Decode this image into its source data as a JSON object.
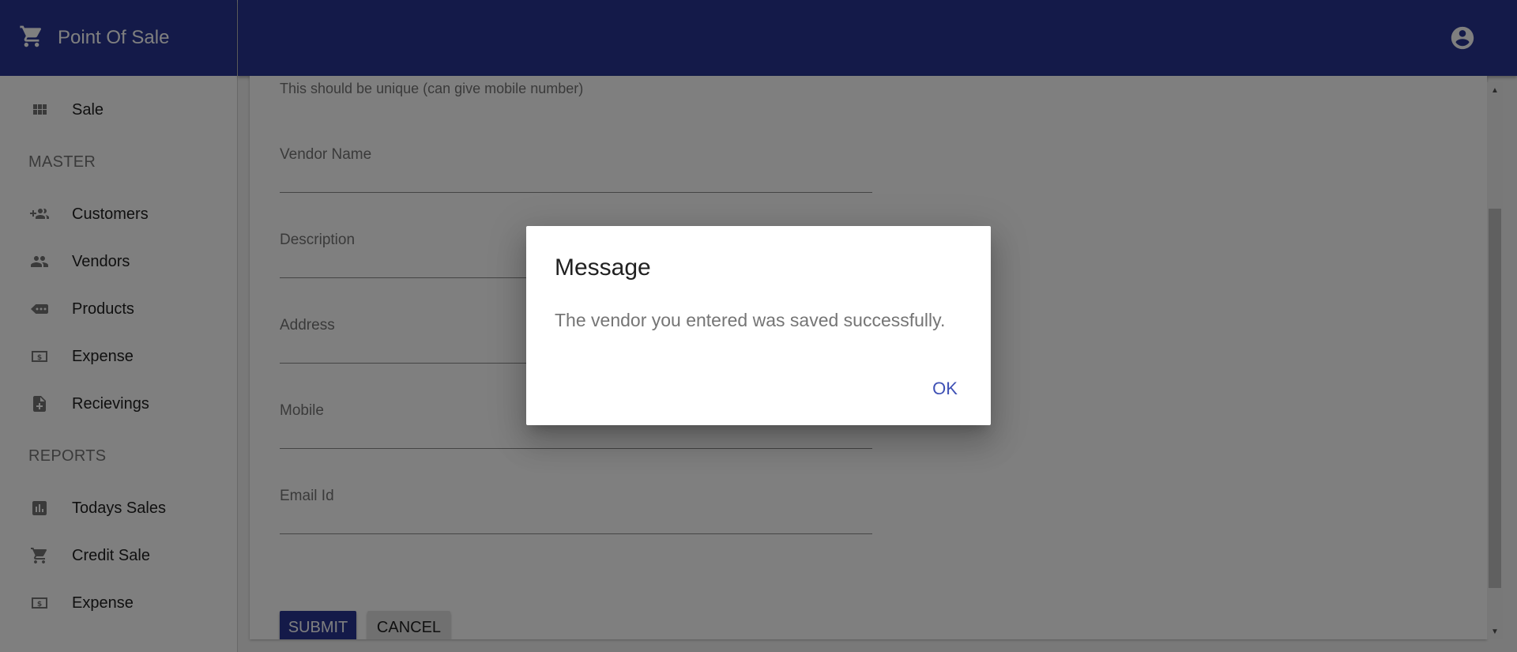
{
  "app": {
    "title": "Point Of Sale"
  },
  "sidebar": {
    "items": [
      {
        "label": "Sale",
        "icon": "grid-icon"
      },
      {
        "label": "Customers",
        "icon": "add-people-icon"
      },
      {
        "label": "Vendors",
        "icon": "people-icon"
      },
      {
        "label": "Products",
        "icon": "tag-icon"
      },
      {
        "label": "Expense",
        "icon": "money-icon"
      },
      {
        "label": "Recievings",
        "icon": "note-add-icon"
      },
      {
        "label": "Todays Sales",
        "icon": "bar-chart-icon"
      },
      {
        "label": "Credit Sale",
        "icon": "cart-icon"
      },
      {
        "label": "Expense",
        "icon": "money-icon"
      }
    ],
    "sections": {
      "master": "MASTER",
      "reports": "REPORTS"
    }
  },
  "form": {
    "helper_text": "This should be unique (can give mobile number)",
    "fields": [
      {
        "label": "Vendor Name",
        "value": ""
      },
      {
        "label": "Description",
        "value": ""
      },
      {
        "label": "Address",
        "value": ""
      },
      {
        "label": "Mobile",
        "value": ""
      },
      {
        "label": "Email Id",
        "value": ""
      }
    ],
    "submit_label": "SUBMIT",
    "cancel_label": "CANCEL"
  },
  "dialog": {
    "title": "Message",
    "message": "The vendor you entered was saved successfully.",
    "ok_label": "OK"
  },
  "colors": {
    "primary": "#283593",
    "accent": "#3f51b5",
    "overlay": "rgba(0,0,0,0.5)"
  }
}
